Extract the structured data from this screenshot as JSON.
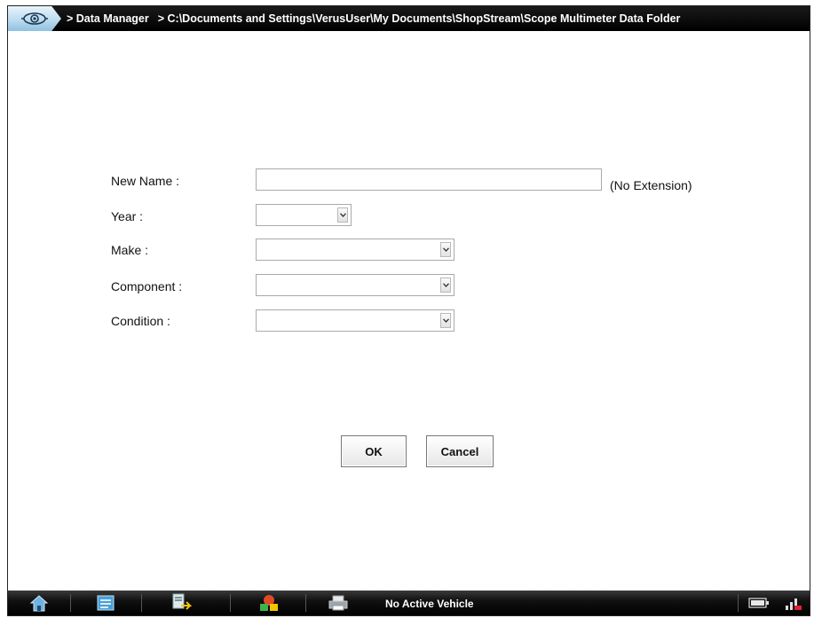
{
  "titlebar": {
    "breadcrumb_1": "> Data Manager",
    "breadcrumb_2": "> C:\\Documents and Settings\\VerusUser\\My Documents\\ShopStream\\Scope Multimeter Data Folder",
    "home_icon": "gear-eye-icon"
  },
  "form": {
    "new_name_label": "New Name :",
    "new_name_value": "",
    "extension_note": "(No Extension)",
    "year_label": "Year :",
    "year_value": "",
    "make_label": "Make :",
    "make_value": "",
    "component_label": "Component :",
    "component_value": "",
    "condition_label": "Condition :",
    "condition_value": ""
  },
  "buttons": {
    "ok": "OK",
    "cancel": "Cancel"
  },
  "toolbar": {
    "status": "No Active Vehicle",
    "icons": [
      "home-icon",
      "list-icon",
      "data-icon",
      "tools-icon",
      "printer-icon",
      "battery-icon",
      "signal-icon"
    ]
  },
  "colors": {
    "titlebar_bg": "#000000",
    "home_tab": "#b9d9ee",
    "text": "#111111"
  }
}
